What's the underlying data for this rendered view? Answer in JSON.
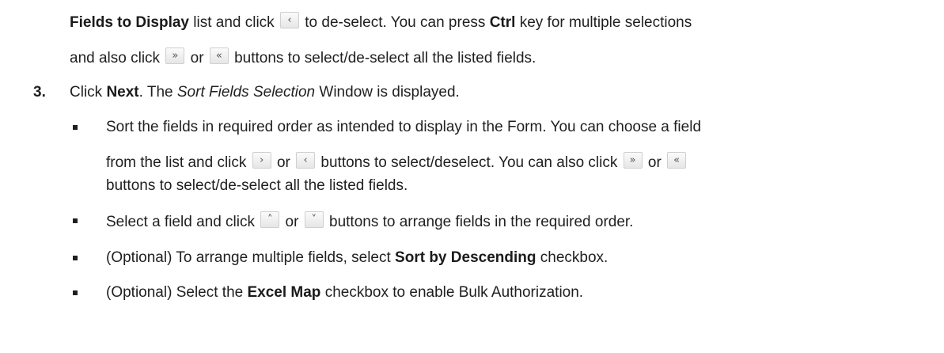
{
  "para": {
    "a_fields": "Fields to Display",
    "a_text1": " list and click ",
    "a_text2": " to de-select. You can press ",
    "a_ctrl": "Ctrl",
    "a_text3": " key for multiple selections",
    "b_text1": "and also click ",
    "b_text2": " or ",
    "b_text3": " buttons to select/de-select all the listed fields."
  },
  "step3": {
    "number": "3.",
    "text1": "Click ",
    "next": "Next",
    "text2": ". The ",
    "window": "Sort Fields Selection",
    "text3": " Window is displayed."
  },
  "bullets": {
    "b1_line1": "Sort the fields in required order as intended to display in the Form. You can choose a field",
    "b1_l2_text1": "from the list and click ",
    "b1_l2_or": " or ",
    "b1_l2_text2": " buttons to select/deselect. You can also click ",
    "b1_l2_or2": " or ",
    "b1_line3": "buttons to select/de-select all the listed fields.",
    "b2_text1": "Select a field and click ",
    "b2_or": " or ",
    "b2_text2": " buttons to arrange fields in the required order.",
    "b3_text1": "(Optional) To arrange multiple fields, select ",
    "b3_bold": "Sort by Descending",
    "b3_text2": " checkbox.",
    "b4_text1": "(Optional) Select the ",
    "b4_bold": "Excel Map",
    "b4_text2": " checkbox to enable Bulk Authorization."
  },
  "icons": {
    "left": "‹",
    "right": "›",
    "double_right": "»",
    "double_left": "«",
    "up": "˄",
    "down": "˅"
  }
}
